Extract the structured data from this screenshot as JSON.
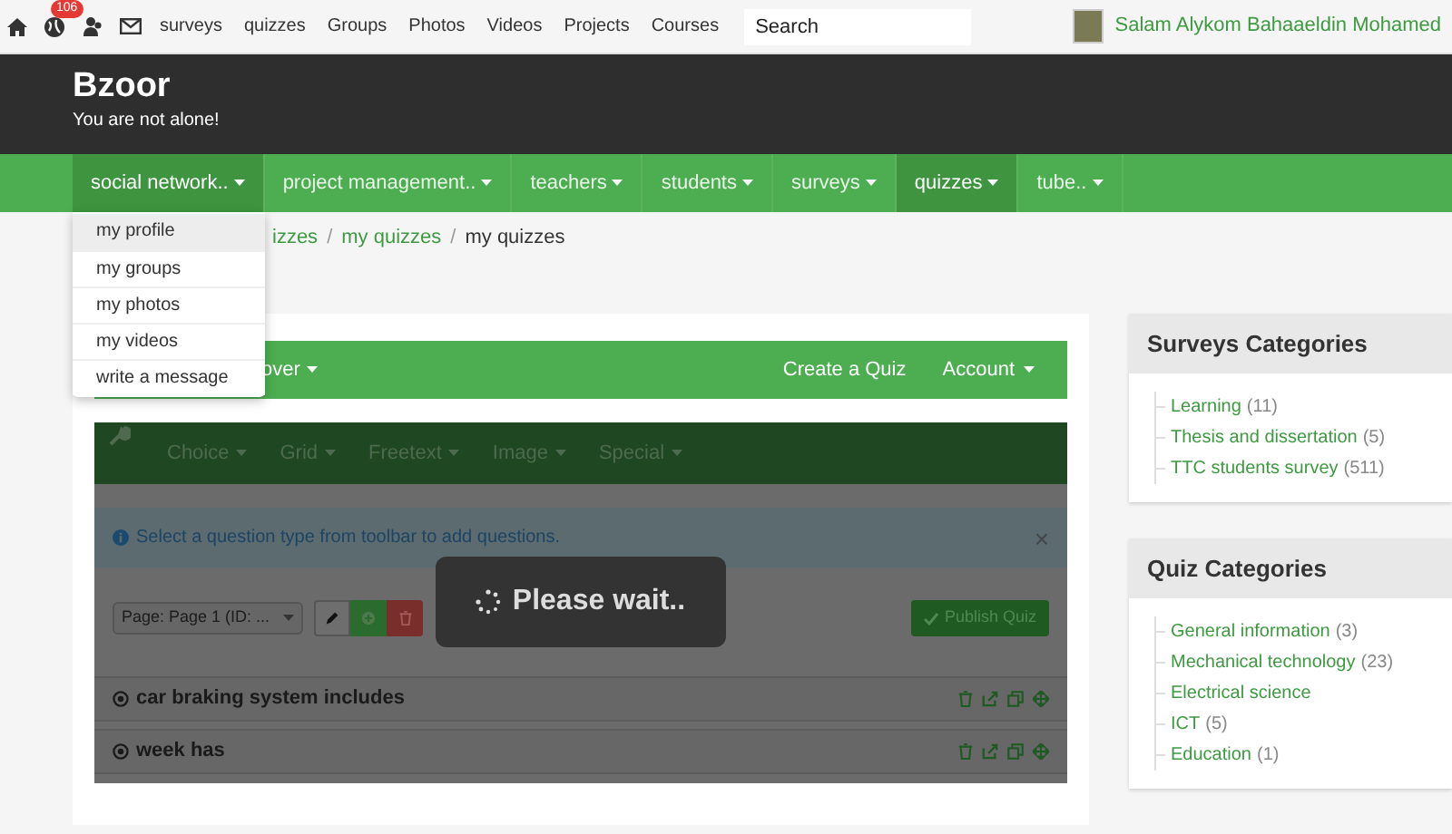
{
  "top_bar": {
    "notification_badge": "106",
    "links": [
      "surveys",
      "quizzes",
      "Groups",
      "Photos",
      "Videos",
      "Projects",
      "Courses"
    ],
    "search": {
      "placeholder": "Search"
    },
    "user": {
      "name": "Salam Alykom Bahaaeldin Mohamed"
    }
  },
  "header": {
    "title": "Bzoor",
    "tagline": "You are not alone!"
  },
  "nav": {
    "items": [
      {
        "label": "social network..",
        "selected": true,
        "expanded": true
      },
      {
        "label": "project management..",
        "selected": false,
        "expanded": false
      },
      {
        "label": "teachers",
        "selected": false,
        "expanded": false
      },
      {
        "label": "students",
        "selected": false,
        "expanded": false
      },
      {
        "label": "surveys",
        "selected": false,
        "expanded": false
      },
      {
        "label": "quizzes",
        "selected": true,
        "expanded": false
      },
      {
        "label": "tube..",
        "selected": false,
        "expanded": false
      }
    ]
  },
  "dropdown": {
    "items": [
      {
        "label": "my profile",
        "selected": true
      },
      {
        "label": "my groups",
        "selected": false
      },
      {
        "label": "my photos",
        "selected": false
      },
      {
        "label": "my videos",
        "selected": false
      },
      {
        "label": "write a message",
        "selected": false
      }
    ]
  },
  "breadcrumb": [
    {
      "label": "izzes",
      "current": false
    },
    {
      "separator": "/",
      "label": "my quizzes",
      "current": false
    },
    {
      "separator": "/",
      "label": "my quizzes",
      "current": true
    }
  ],
  "quiz_navbar": {
    "left": [
      {
        "label": "over"
      }
    ],
    "right": [
      {
        "label": "Create a Quiz",
        "caret": false
      },
      {
        "label": "Account",
        "caret": true
      }
    ]
  },
  "editor": {
    "toolbar": [
      "Choice",
      "Grid",
      "Freetext",
      "Image",
      "Special"
    ],
    "alert": "Select a question type from toolbar to add questions.",
    "alert_close": "×",
    "page_select": "Page: Page 1 (ID: ...",
    "publish_button": "Publish Quiz",
    "questions": [
      "car braking system includes",
      "week has"
    ],
    "loading": "Please wait.."
  },
  "sidebar": [
    {
      "title": "Surveys Categories",
      "items": [
        {
          "label": "Learning",
          "count": "(11)"
        },
        {
          "label": "Thesis and dissertation",
          "count": "(5)"
        },
        {
          "label": "TTC students survey",
          "count": "(511)"
        }
      ]
    },
    {
      "title": "Quiz Categories",
      "items": [
        {
          "label": "General information",
          "count": "(3)"
        },
        {
          "label": "Mechanical technology",
          "count": "(23)"
        },
        {
          "label": "Electrical science"
        },
        {
          "label": "ICT",
          "count": "(5)"
        },
        {
          "label": "Education",
          "count": "(1)"
        }
      ]
    }
  ]
}
